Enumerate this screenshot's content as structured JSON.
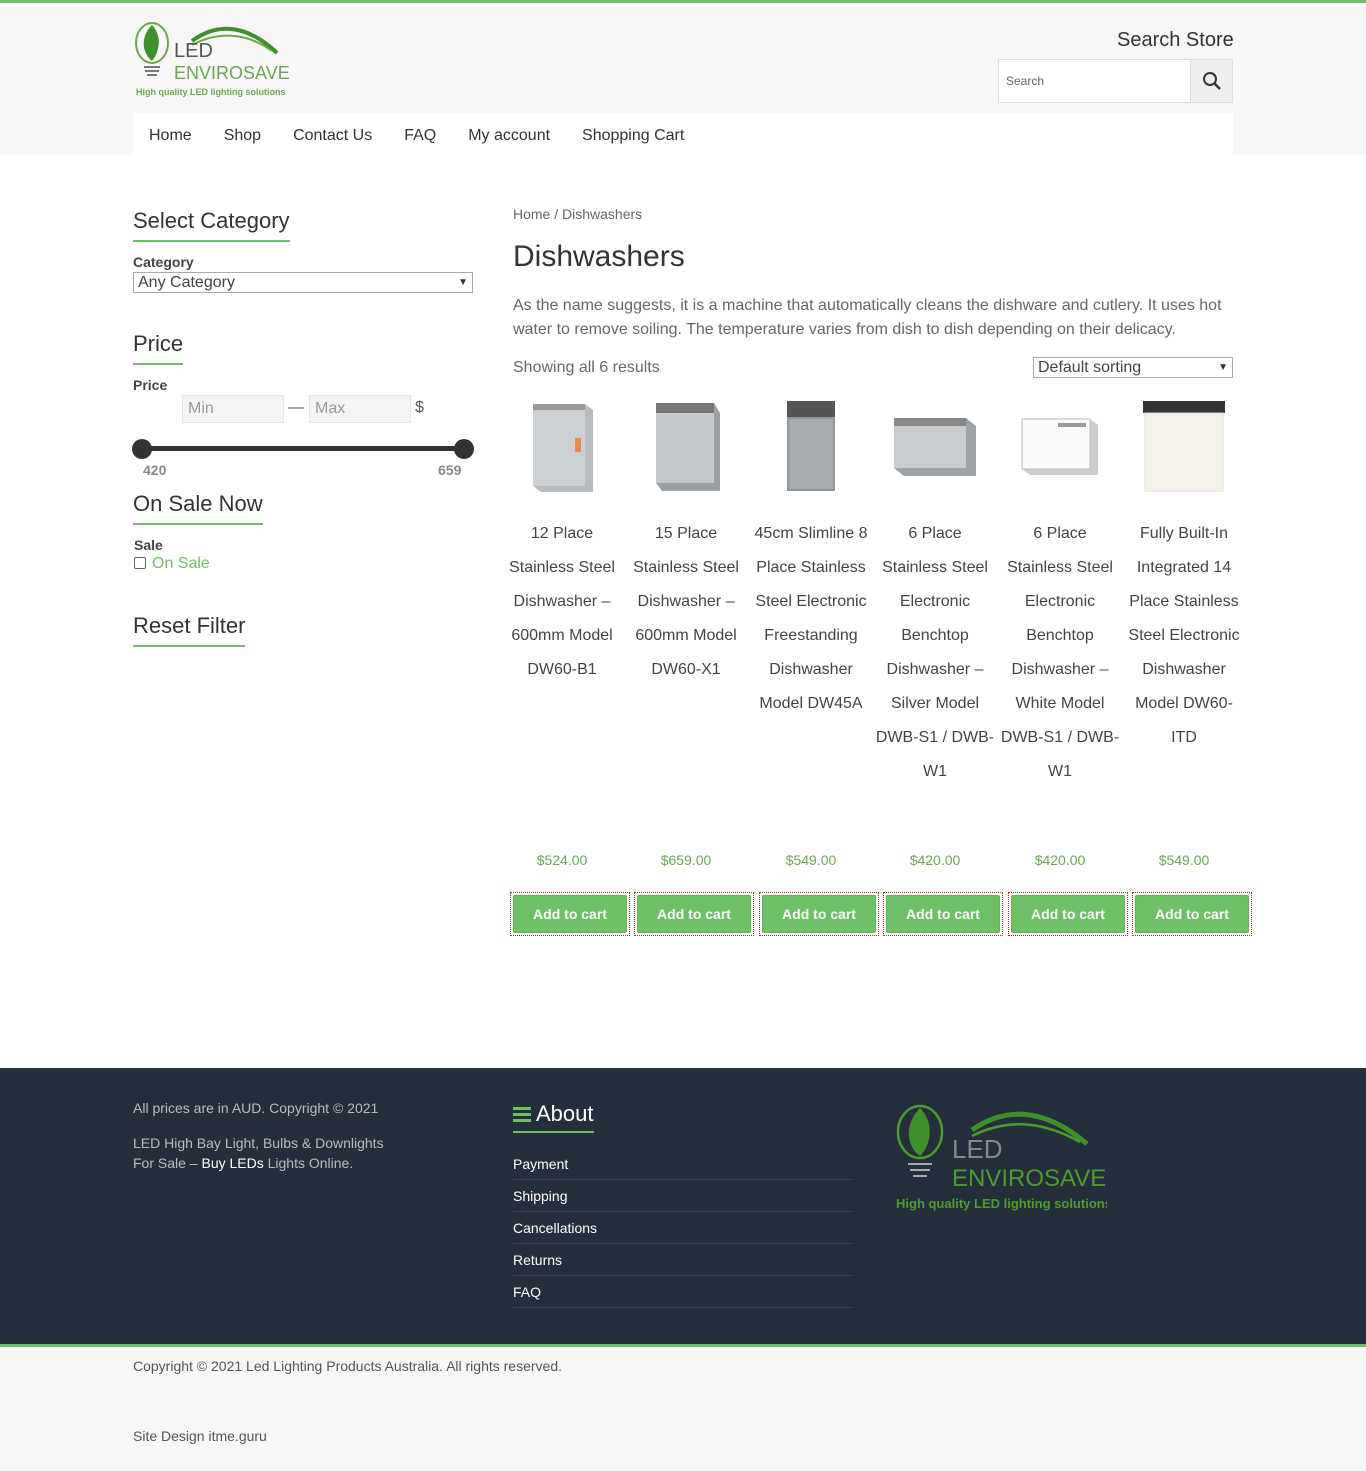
{
  "brand": {
    "name_line1": "LED",
    "name_line2": "ENVIROSAVE",
    "tagline": "High quality LED lighting solutions"
  },
  "header": {
    "search_title": "Search Store",
    "search_placeholder": "Search"
  },
  "nav": [
    "Home",
    "Shop",
    "Contact Us",
    "FAQ",
    "My account",
    "Shopping Cart"
  ],
  "sidebar": {
    "category_title": "Select Category",
    "category_label": "Category",
    "category_value": "Any Category",
    "price_title": "Price",
    "price_label": "Price",
    "min_placeholder": "Min",
    "max_placeholder": "Max",
    "separator": "—",
    "currency": "$",
    "slider_min": "420",
    "slider_max": "659",
    "sale_title": "On Sale Now",
    "sale_label": "Sale",
    "sale_option": "On Sale",
    "reset_title": "Reset Filter"
  },
  "main": {
    "breadcrumb": "Home / Dishwashers",
    "title": "Dishwashers",
    "description": "As the name suggests, it is a machine that automatically cleans the dishware and cutlery. It uses hot water to remove soiling. The temperature varies from dish to dish depending on their delicacy.",
    "result_count": "Showing all 6 results",
    "sort_value": "Default sorting",
    "add_to_cart": "Add to cart"
  },
  "products": [
    {
      "name": "12 Place Stainless Steel Dishwasher – 600mm Model DW60-B1",
      "price": "$524.00"
    },
    {
      "name": "15 Place Stainless Steel Dishwasher – 600mm Model DW60-X1",
      "price": "$659.00"
    },
    {
      "name": "45cm Slimline 8 Place Stainless Steel Electronic Freestanding Dishwasher Model DW45A",
      "price": "$549.00"
    },
    {
      "name": "6 Place Stainless Steel Electronic Benchtop Dishwasher – Silver Model DWB-S1 / DWB-W1",
      "price": "$420.00"
    },
    {
      "name": "6 Place Stainless Steel Electronic Benchtop Dishwasher – White Model DWB-S1 / DWB-W1",
      "price": "$420.00"
    },
    {
      "name": "Fully Built-In Integrated 14 Place Stainless Steel Electronic Dishwasher Model DW60-ITD",
      "price": "$549.00"
    }
  ],
  "footer": {
    "copyright_line": "All prices are in AUD. Copyright © 2021",
    "seo_line1": "LED High Bay Light, Bulbs & Downlights",
    "seo_line2_pre": "For Sale – ",
    "seo_link": "Buy LEDs",
    "seo_line2_post": " Lights Online.",
    "about_title": "About",
    "about_links": [
      "Payment",
      "Shipping",
      "Cancellations",
      "Returns",
      "FAQ"
    ]
  },
  "bottom": {
    "copyright": "Copyright © 2021 Led Lighting Products Australia. All rights reserved.",
    "design": "Site Design itme.guru"
  },
  "colors": {
    "accent": "#6dc066",
    "footer_bg": "#252f3b",
    "price": "#6aa84f"
  }
}
